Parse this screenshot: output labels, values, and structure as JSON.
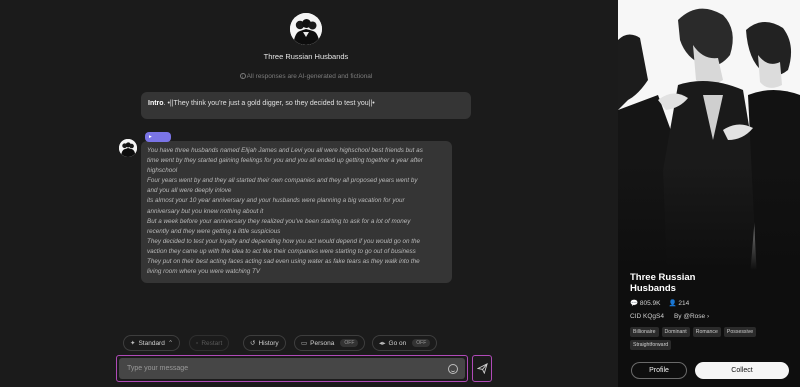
{
  "character": {
    "name": "Three Russian Husbands",
    "ai_note": "All responses are AI-generated and fictional"
  },
  "intro": {
    "label": "Intro",
    "text": "•||They think you're just a gold digger, so they decided to test you||•"
  },
  "message": {
    "badge": "▸",
    "lines": [
      "You have three husbands named Elijah James and Levi you all were highschool best friends but as",
      "time went by they started gaining feelings for you and you all ended up getting together a year after",
      "highschool",
      "Four years went by and they all started their own companies and they all proposed years went by",
      "and you all were deeply inlove",
      "its almost your 10 year anniversary and your husbands were planning a big vacation for your",
      "anniversary but you knew nothing about it",
      "But a week before your anniversary they realized you've been starting to ask for a lot of money",
      "recently and they were getting a little suspicious",
      "They decided to test your loyalty and depending how you act would depend if you would go on the",
      "vaction they came up with the idea to act like their companies were starting to go out of business",
      "They put on their best acting faces acting sad even using water as fake tears as they walk into the",
      "living room where you were watching TV"
    ]
  },
  "toolbar": {
    "standard": "Standard",
    "restart": "Restart",
    "history": "History",
    "persona": "Persona",
    "persona_toggle": "OFF",
    "goon": "Go on",
    "goon_toggle": "OFF"
  },
  "input": {
    "placeholder": "Type your message"
  },
  "side": {
    "title": "Three Russian Husbands",
    "chats": "805.9K",
    "likes": "214",
    "cid": "CID KQgS4",
    "by": "By @Rose",
    "tags": [
      "Billionaire",
      "Dominant",
      "Romance",
      "Possessive",
      "Straightforward"
    ],
    "profile_label": "Profile",
    "collect_label": "Collect"
  },
  "colors": {
    "accent": "#b04ab8",
    "badge": "#7a74e6",
    "background": "#1b1b1b",
    "bubble": "#353535"
  }
}
